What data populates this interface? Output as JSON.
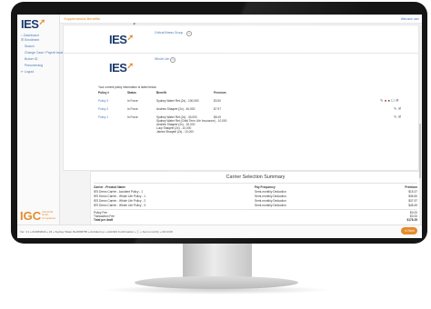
{
  "app": {
    "logo": "IES",
    "page_title": "Supplemental Benefits",
    "welcome": "Welcome user"
  },
  "sidebar": {
    "items": [
      {
        "label": "Dashboard"
      },
      {
        "label": "Enrollment"
      },
      {
        "label": "Search"
      },
      {
        "label": "Change Case / Payroll location"
      },
      {
        "label": "Broker ID"
      },
      {
        "label": "Prescreening"
      },
      {
        "label": "Logout"
      }
    ],
    "brand": {
      "logo": "IGC",
      "line1": "Industrial",
      "line2": "Grain",
      "line3": "Companies"
    }
  },
  "carriers": [
    {
      "logo": "IES",
      "name": "Critical Illness Group"
    },
    {
      "logo": "IES",
      "name": "Whole Life"
    }
  ],
  "policies": {
    "intro": "Your current policy information is listed below.",
    "headers": {
      "policy": "Policy #",
      "status": "Status",
      "benefit": "Benefit",
      "premium": "Premium"
    },
    "rows": [
      {
        "policy": "Policy 3",
        "status": "In Force",
        "benefit": "Sydney Water Ret (2x) - 100,000",
        "premium": "$3.50"
      },
      {
        "policy": "Policy 2",
        "status": "In Force",
        "benefit": "Andrew Shaqeel (2x) - 40,000",
        "premium": "$7.97"
      },
      {
        "policy": "Policy 1",
        "status": "In Force",
        "benefit": "Sydney Water Ret (2x) - 40,000",
        "benefit_more": [
          "Sydney Water Ret (Child Term Life Insurance) - 10,000",
          "Andrew Shaqeel (2x) - 20,000",
          "Lucy Shaqeel (2x) - 10,000",
          "James Shaqeel (2x) - 10,000"
        ],
        "premium": "$8.49"
      }
    ]
  },
  "summary": {
    "title": "Carrier Selection Summary",
    "headers": {
      "product": "Carrier - Product Name",
      "frequency": "Pay Frequency",
      "premium": "Premium"
    },
    "rows": [
      {
        "product": "IES Demo Carrier - Accident Policy - 1",
        "frequency": "Semi-monthly Deduction",
        "premium": "$15.37"
      },
      {
        "product": "IES Demo Carrier - Whole Life Policy - 1",
        "frequency": "Semi-monthly Deduction",
        "premium": "$36.50"
      },
      {
        "product": "IES Demo Carrier - Whole Life Policy - 2",
        "frequency": "Semi-monthly Deduction",
        "premium": "$37.97"
      },
      {
        "product": "IES Demo Carrier - Whole Life Policy - 3",
        "frequency": "Semi-monthly Deduction",
        "premium": "$48.49"
      }
    ],
    "totals": [
      {
        "label": "Policy Fee",
        "value": "$0.00"
      },
      {
        "label": "Transaction Fee",
        "value": "$0.00"
      },
      {
        "label": "Total per draft",
        "value": "$178.35"
      }
    ]
  },
  "footer": {
    "text": "Ver. 4.1 » 02/28/2024 » 24 » Sydney Water Ret/PA8765 » Accident Lp » Add IES Confirmation » ⓘ » Semi-monthly » 00:13:06",
    "next_label": "Next"
  }
}
